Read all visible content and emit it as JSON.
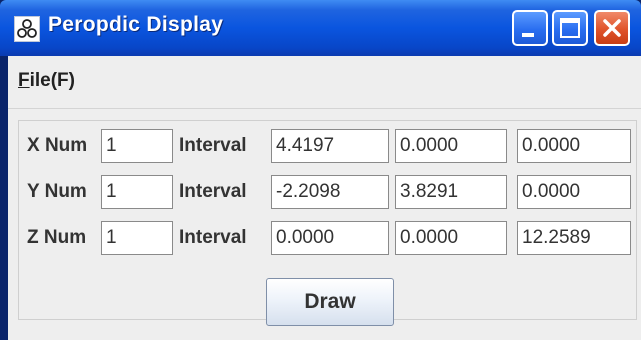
{
  "window": {
    "title": "Peropdic Display"
  },
  "menubar": {
    "file_label": "File(F)"
  },
  "rows": [
    {
      "num_label": "X Num",
      "num_value": "1",
      "interval_label": "Interval",
      "values": [
        "4.4197",
        "0.0000",
        "0.0000"
      ]
    },
    {
      "num_label": "Y Num",
      "num_value": "1",
      "interval_label": "Interval",
      "values": [
        "-2.2098",
        "3.8291",
        "0.0000"
      ]
    },
    {
      "num_label": "Z Num",
      "num_value": "1",
      "interval_label": "Interval",
      "values": [
        "0.0000",
        "0.0000",
        "12.2589"
      ]
    }
  ],
  "actions": {
    "draw_label": "Draw"
  },
  "icons": {
    "app": "java-molecule-icon",
    "minimize": "minimize-icon",
    "maximize": "maximize-icon",
    "close": "close-icon"
  },
  "colors": {
    "titlebar": "#0a55df",
    "close_button": "#e0532a",
    "client_bg": "#eeeeee"
  }
}
